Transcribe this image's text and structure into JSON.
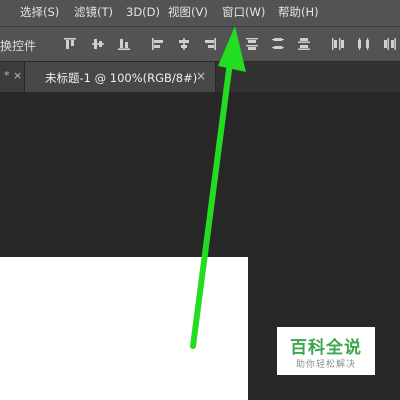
{
  "menubar": {
    "items": [
      "选择(S)",
      "滤镜(T)",
      "3D(D)",
      "视图(V)",
      "窗口(W)",
      "帮助(H)"
    ]
  },
  "options_bar": {
    "label": "换控件",
    "align_icons": [
      "align-top-edges-icon",
      "align-vertical-centers-icon",
      "align-bottom-edges-icon",
      "align-left-edges-icon",
      "align-horizontal-centers-icon",
      "align-right-edges-icon",
      "distribute-top-edges-icon",
      "distribute-vertical-centers-icon",
      "distribute-bottom-edges-icon",
      "distribute-left-edges-icon",
      "distribute-horizontal-centers-icon",
      "distribute-right-edges-icon"
    ]
  },
  "tabs": {
    "previous_close": "*  ×",
    "active_title": "未标题-1 @ 100%(RGB/8#)",
    "active_close": "×"
  },
  "annotation": {
    "color": "#22dd22",
    "target_menu": "窗口(W)"
  },
  "watermark": {
    "title": "百科全说",
    "subtitle": "助你轻松解决",
    "color": "#3aa84a"
  }
}
